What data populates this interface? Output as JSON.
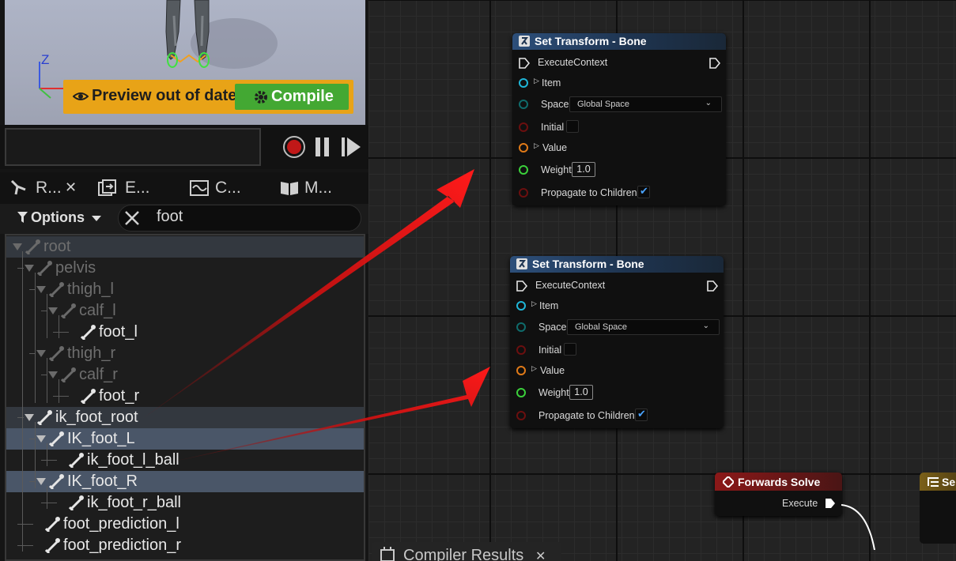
{
  "viewport": {
    "axis_label": "Z",
    "preview_label": "Preview out of date",
    "compile_label": "Compile"
  },
  "transport": {
    "record": "record-icon",
    "pause": "pause-icon",
    "step": "step-icon"
  },
  "tabs": [
    {
      "label": "R...",
      "icon": "rig-hierarchy-icon",
      "closable": true
    },
    {
      "label": "E...",
      "icon": "execution-stack-icon"
    },
    {
      "label": "C...",
      "icon": "curve-icon"
    },
    {
      "label": "M...",
      "icon": "book-icon"
    }
  ],
  "filter": {
    "options_label": "Options",
    "search_value": "foot"
  },
  "hierarchy": [
    {
      "label": "root",
      "depth": 0,
      "dim": true
    },
    {
      "label": "pelvis",
      "depth": 1,
      "dim": true
    },
    {
      "label": "thigh_l",
      "depth": 2,
      "dim": true
    },
    {
      "label": "calf_l",
      "depth": 3,
      "dim": true
    },
    {
      "label": "foot_l",
      "depth": 4,
      "dim": false
    },
    {
      "label": "thigh_r",
      "depth": 2,
      "dim": true
    },
    {
      "label": "calf_r",
      "depth": 3,
      "dim": true
    },
    {
      "label": "foot_r",
      "depth": 4,
      "dim": false
    },
    {
      "label": "ik_foot_root",
      "depth": 1,
      "dim": false
    },
    {
      "label": "IK_foot_L",
      "depth": 2,
      "dim": false,
      "selected": true
    },
    {
      "label": "ik_foot_l_ball",
      "depth": 3,
      "dim": false
    },
    {
      "label": "IK_foot_R",
      "depth": 2,
      "dim": false,
      "selected": true
    },
    {
      "label": "ik_foot_r_ball",
      "depth": 3,
      "dim": false
    },
    {
      "label": "foot_prediction_l",
      "depth": 1,
      "dim": false
    },
    {
      "label": "foot_prediction_r",
      "depth": 1,
      "dim": false
    }
  ],
  "nodes": [
    {
      "title": "Set Transform - Bone",
      "execute": "ExecuteContext",
      "item": "Item",
      "space": "Space",
      "space_value": "Global Space",
      "initial": "Initial",
      "value": "Value",
      "weight": "Weight",
      "weight_value": "1.0",
      "propagate": "Propagate to Children"
    },
    {
      "title": "Set Transform - Bone",
      "execute": "ExecuteContext",
      "item": "Item",
      "space": "Space",
      "space_value": "Global Space",
      "initial": "Initial",
      "value": "Value",
      "weight": "Weight",
      "weight_value": "1.0",
      "propagate": "Propagate to Children"
    }
  ],
  "forwards_solve": {
    "title": "Forwards Solve",
    "execute": "Execute"
  },
  "partial_node": {
    "title": "Se"
  },
  "compiler": {
    "label": "Compiler Results"
  },
  "colors": {
    "preview_warning": "#e8a317",
    "compile_green": "#43a833",
    "node_header": "#2d4f7a",
    "forwards_header": "#8b1818",
    "arrow_red": "#e01010",
    "selection": "#4a5668"
  }
}
